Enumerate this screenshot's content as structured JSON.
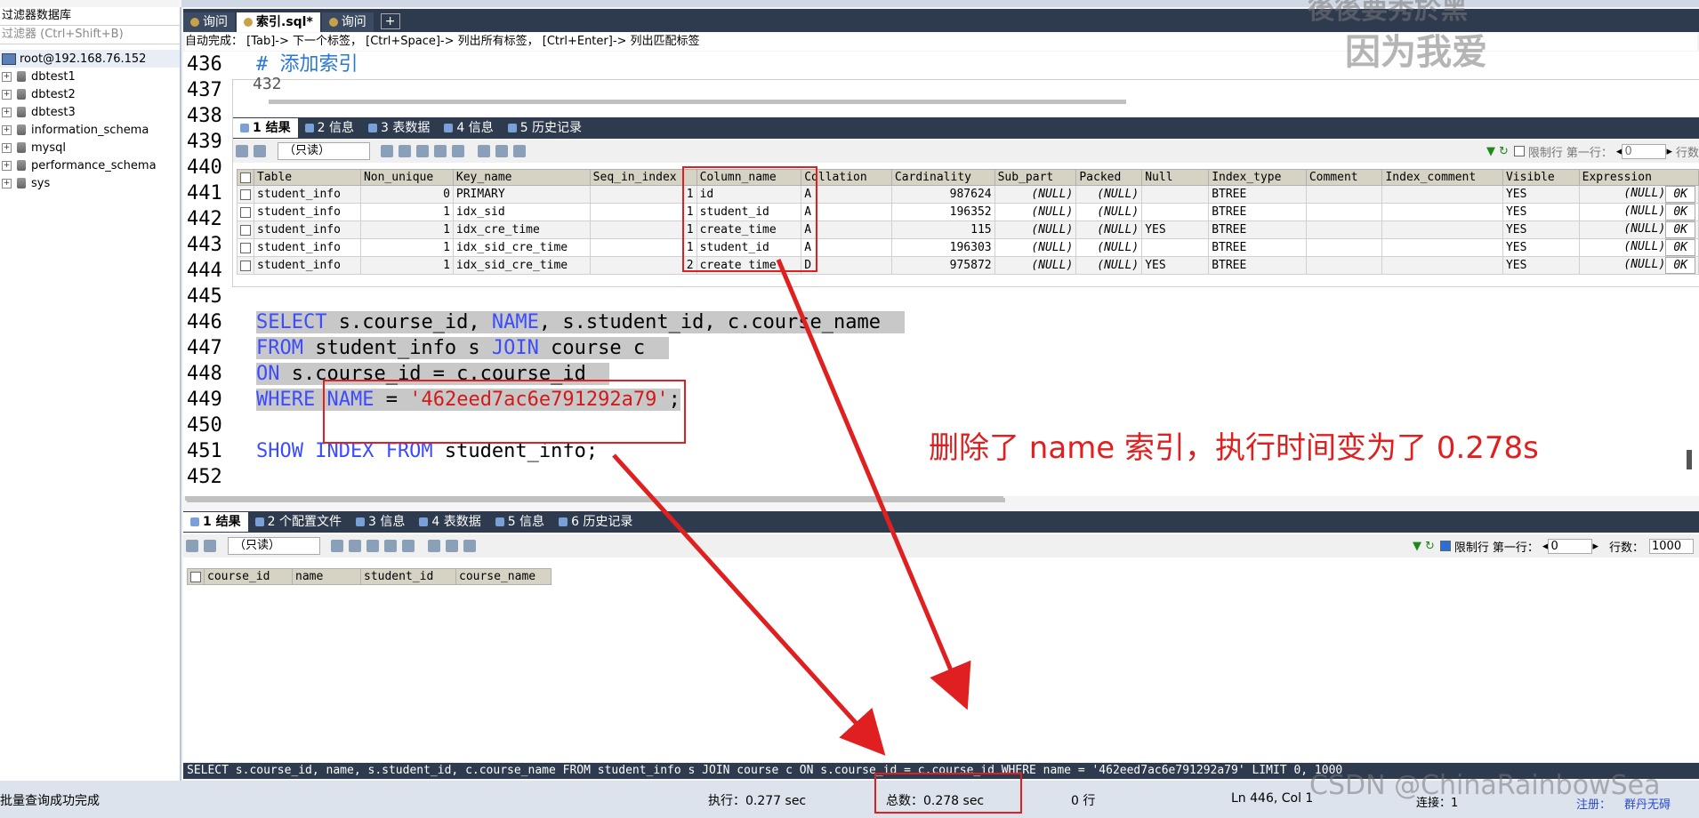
{
  "left_panel": {
    "title": "过滤器数据库",
    "filter_placeholder": "过滤器 (Ctrl+Shift+B)",
    "connection": "root@192.168.76.152",
    "databases": [
      "dbtest1",
      "dbtest2",
      "dbtest3",
      "information_schema",
      "mysql",
      "performance_schema",
      "sys"
    ]
  },
  "tabs": [
    {
      "label": "询问"
    },
    {
      "label": "索引.sql*",
      "active": true
    },
    {
      "label": "询问"
    }
  ],
  "autocomplete_hint": "自动完成： [Tab]-> 下一个标签， [Ctrl+Space]-> 列出所有标签， [Ctrl+Enter]-> 列出匹配标签",
  "editor": {
    "lines": [
      "436",
      "437",
      "438",
      "439",
      "440",
      "441",
      "442",
      "443",
      "444",
      "445",
      "446",
      "447",
      "448",
      "449",
      "450",
      "451",
      "452"
    ],
    "comment": "# 添加索引",
    "hidden_line": "432",
    "q_select": "SELECT",
    "q_select_rest": " s.course_id, ",
    "q_name": "NAME",
    "q_select_rest2": ", s.student_id, c.course_name",
    "q_from": "FROM",
    "q_from_rest": " student_info s ",
    "q_join": "JOIN",
    "q_join_rest": " course c",
    "q_on": "ON",
    "q_on_rest": " s.course_id = c.course_id",
    "q_where": "WHERE",
    "q_where_name": "NAME",
    "q_eq": " = ",
    "q_str": "'462eed7ac6e791292a79'",
    "q_semicolon": ";",
    "q_show": "SHOW INDEX FROM",
    "q_show_rest": " student_info;"
  },
  "overlay_result": {
    "tabs": [
      "1 结果",
      "2 信息",
      "3 表数据",
      "4 信息",
      "5 历史记录"
    ],
    "readonly": "（只读）",
    "limit_label": "限制行",
    "first_row_label": "第一行：",
    "first_row_value": "0",
    "rows_label": "行数",
    "columns": [
      "Table",
      "Non_unique",
      "Key_name",
      "Seq_in_index",
      "Column_name",
      "Collation",
      "Cardinality",
      "Sub_part",
      "Packed",
      "Null",
      "Index_type",
      "Comment",
      "Index_comment",
      "Visible",
      "Expression"
    ],
    "rows": [
      [
        "student_info",
        "0",
        "PRIMARY",
        "1",
        "id",
        "A",
        "987624",
        "(NULL)",
        "(NULL)",
        "",
        "BTREE",
        "",
        "",
        "YES",
        "(NULL)"
      ],
      [
        "student_info",
        "1",
        "idx_sid",
        "1",
        "student_id",
        "A",
        "196352",
        "(NULL)",
        "(NULL)",
        "",
        "BTREE",
        "",
        "",
        "YES",
        "(NULL)"
      ],
      [
        "student_info",
        "1",
        "idx_cre_time",
        "1",
        "create_time",
        "A",
        "115",
        "(NULL)",
        "(NULL)",
        "YES",
        "BTREE",
        "",
        "",
        "YES",
        "(NULL)"
      ],
      [
        "student_info",
        "1",
        "idx_sid_cre_time",
        "1",
        "student_id",
        "A",
        "196303",
        "(NULL)",
        "(NULL)",
        "",
        "BTREE",
        "",
        "",
        "YES",
        "(NULL)"
      ],
      [
        "student_info",
        "1",
        "idx_sid_cre_time",
        "2",
        "create_time",
        "D",
        "975872",
        "(NULL)",
        "(NULL)",
        "YES",
        "BTREE",
        "",
        "",
        "YES",
        "(NULL)"
      ]
    ],
    "ok_label": "0K"
  },
  "annotation": "删除了 name 索引，执行时间变为了 0.278s",
  "bottom_result": {
    "tabs": [
      "1 结果",
      "2 个配置文件",
      "3 信息",
      "4 表数据",
      "5 信息",
      "6 历史记录"
    ],
    "readonly": "（只读）",
    "limit_label": "限制行",
    "first_row_label": "第一行：",
    "first_row_value": "0",
    "rows_label": "行数：",
    "rows_value": "1000",
    "columns": [
      "course_id",
      "name",
      "student_id",
      "course_name"
    ]
  },
  "sql_bar": "SELECT s.course_id, name, s.student_id, c.course_name FROM student_info s JOIN course c ON s.course_id = c.course_id WHERE name = '462eed7ac6e791292a79' LIMIT 0, 1000",
  "status": {
    "message": "批量查询成功完成",
    "exec": "执行：0.277 sec",
    "total": "总数：0.278 sec",
    "rows": "0 行",
    "position": "Ln 446, Col 1",
    "conn": "连接：1",
    "register": "注册：",
    "user": "群丹无碍"
  },
  "watermark": {
    "top": "因为我爱",
    "top2": "後後要秀於黑",
    "csdn": "CSDN @ChinaRainbowSea"
  },
  "colors": {
    "accent": "#2e3a4e",
    "annotation": "#e02020",
    "keyword": "#3b4cff",
    "string": "#d21a1a"
  }
}
